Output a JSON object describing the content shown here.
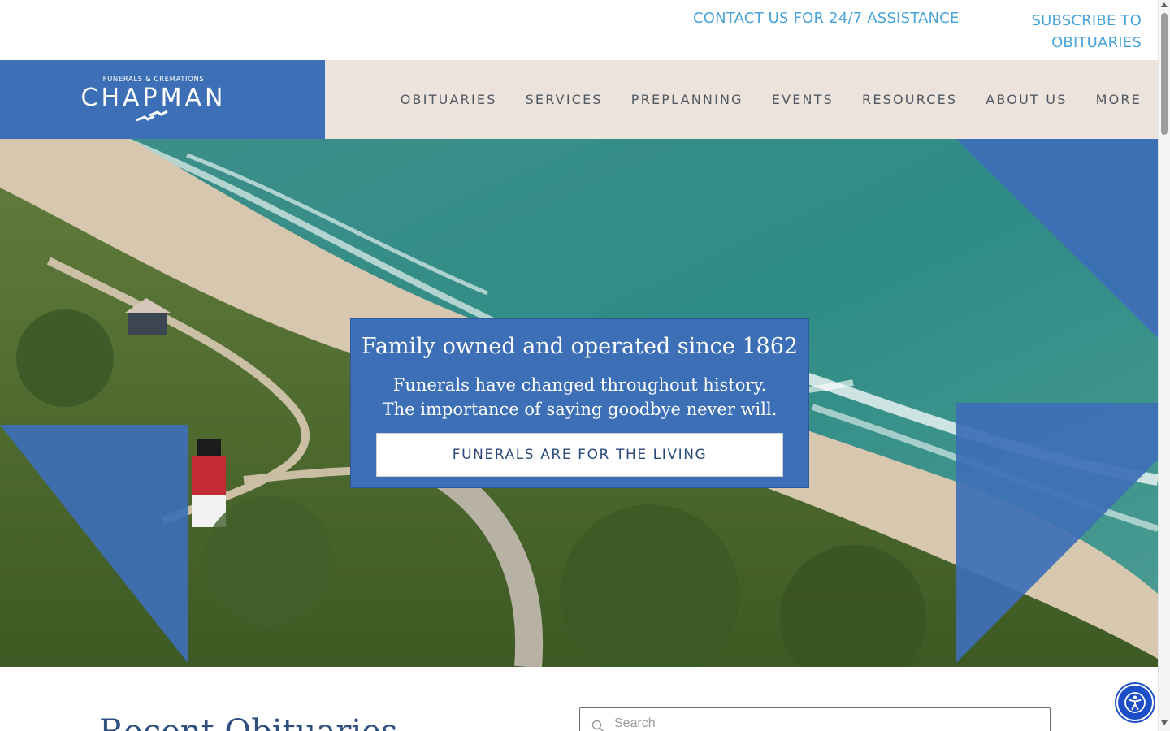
{
  "topbar": {
    "contact_label": "CONTACT US FOR 24/7 ASSISTANCE",
    "subscribe_label": "SUBSCRIBE TO OBITUARIES"
  },
  "logo": {
    "tagline": "FUNERALS & CREMATIONS",
    "name": "CHAPMAN"
  },
  "nav": {
    "items": [
      {
        "label": "OBITUARIES"
      },
      {
        "label": "SERVICES"
      },
      {
        "label": "PREPLANNING"
      },
      {
        "label": "EVENTS"
      },
      {
        "label": "RESOURCES"
      },
      {
        "label": "ABOUT US"
      },
      {
        "label": "MORE"
      }
    ]
  },
  "hero": {
    "heading": "Family owned and operated since 1862",
    "subheading": "Funerals have changed throughout history. The importance of saying goodbye never will.",
    "cta_label": "FUNERALS ARE FOR THE LIVING"
  },
  "obituaries": {
    "title": "Recent Obituaries",
    "search_placeholder": "Search"
  },
  "accessibility": {
    "icon": "accessibility-icon"
  },
  "colors": {
    "brand_blue": "#3d6fb6",
    "link_blue": "#4aa3d9",
    "header_bg": "#ebe3dc",
    "nav_text": "#505863"
  }
}
